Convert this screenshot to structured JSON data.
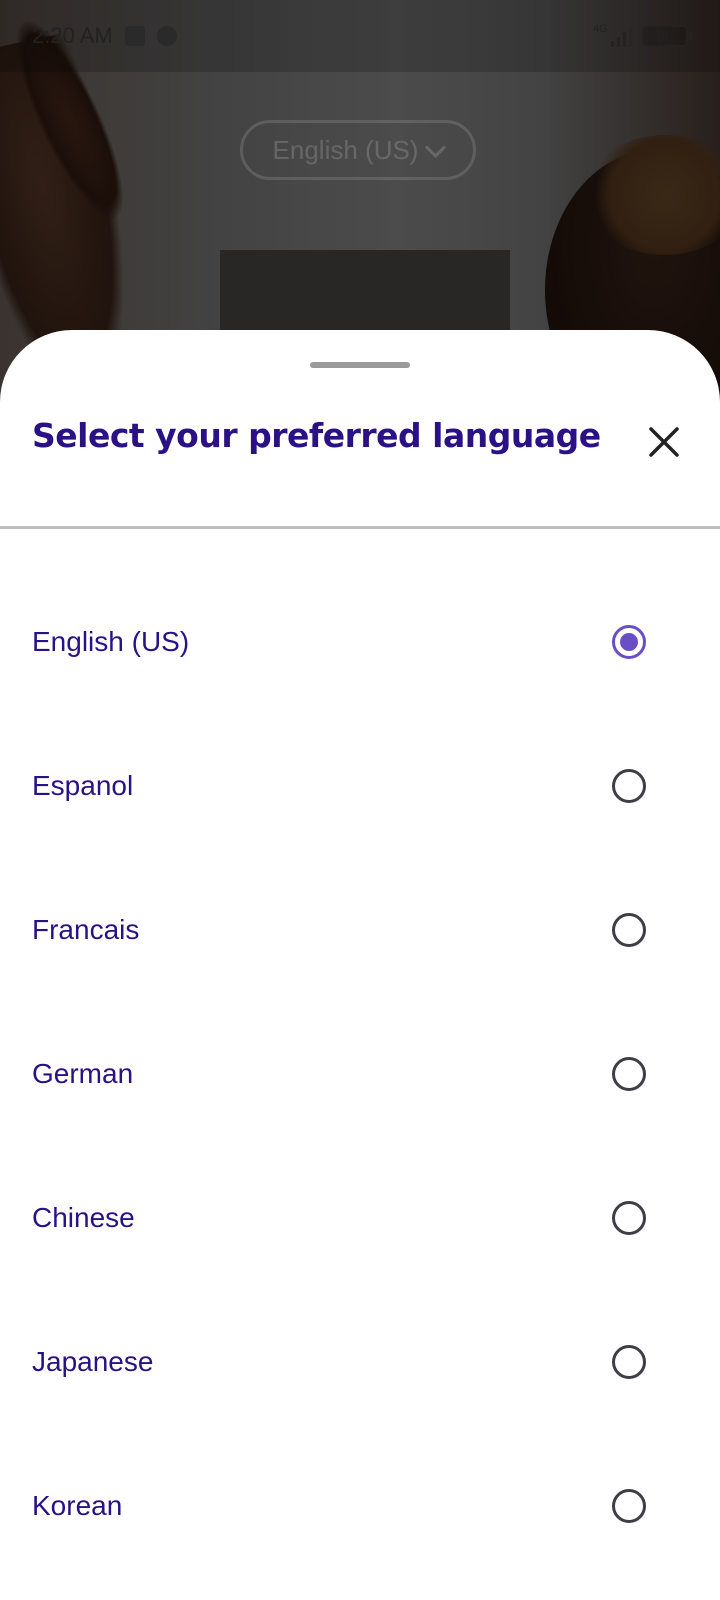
{
  "status_bar": {
    "time": "2:20 AM",
    "network_label": "4G",
    "battery": "98",
    "icons": [
      "notification-app-icon",
      "sync-icon",
      "signal-icon",
      "battery-icon"
    ]
  },
  "background": {
    "language_pill": "English (US)",
    "icons": [
      "chevron-down-icon"
    ]
  },
  "sheet": {
    "title": "Select your preferred language",
    "close_icon": "close-icon"
  },
  "languages": [
    {
      "label": "English (US)",
      "selected": true
    },
    {
      "label": "Espanol",
      "selected": false
    },
    {
      "label": "Francais",
      "selected": false
    },
    {
      "label": "German",
      "selected": false
    },
    {
      "label": "Chinese",
      "selected": false
    },
    {
      "label": "Japanese",
      "selected": false
    },
    {
      "label": "Korean",
      "selected": false
    }
  ],
  "colors": {
    "title": "#2a1185",
    "accent": "#6a4ec8",
    "divider": "#bdbdbd"
  }
}
